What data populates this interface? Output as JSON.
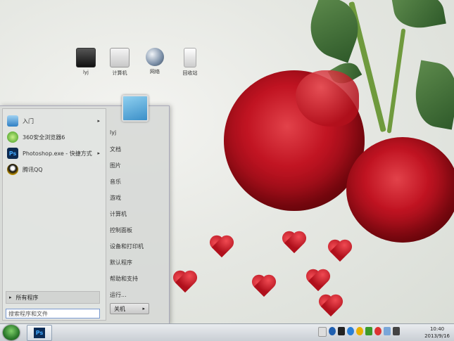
{
  "desktop_icons": [
    {
      "label": "lyj",
      "icon": "user-folder-icon"
    },
    {
      "label": "计算机",
      "icon": "computer-icon"
    },
    {
      "label": "网络",
      "icon": "network-globe-icon"
    },
    {
      "label": "回收站",
      "icon": "recycle-bin-icon"
    }
  ],
  "start_menu": {
    "programs": [
      {
        "label": "入门",
        "icon": "getting-started-icon",
        "has_submenu": true
      },
      {
        "label": "360安全浏览器6",
        "icon": "360-browser-icon",
        "has_submenu": false
      },
      {
        "label": "Photoshop.exe - 快捷方式",
        "icon": "photoshop-icon",
        "has_submenu": true
      },
      {
        "label": "腾讯QQ",
        "icon": "qq-penguin-icon",
        "has_submenu": false
      }
    ],
    "all_programs": "所有程序",
    "search_placeholder": "搜索程序和文件",
    "right_links": [
      "lyj",
      "文档",
      "图片",
      "音乐",
      "游戏",
      "计算机",
      "控制面板",
      "设备和打印机",
      "默认程序",
      "帮助和支持",
      "运行..."
    ],
    "shutdown_label": "关机"
  },
  "taskbar": {
    "start_orb": "windows-start-orb",
    "pinned_label": "Ps",
    "time": "10:40",
    "date": "2013/9/16"
  }
}
